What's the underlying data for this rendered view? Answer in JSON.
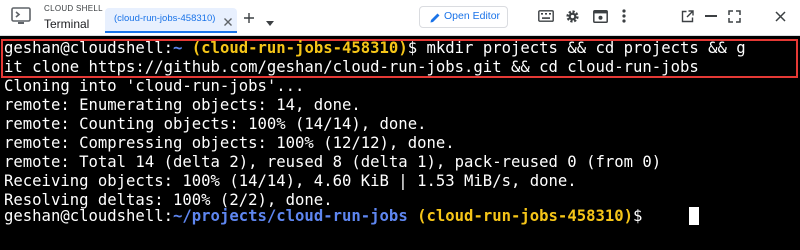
{
  "app": {
    "name": "CLOUD SHELL",
    "title": "Terminal"
  },
  "tabs": [
    {
      "label": "(cloud-run-jobs-458310)"
    }
  ],
  "toolbar": {
    "open_editor_label": "Open Editor",
    "icons": [
      "keyboard-icon",
      "gear-icon",
      "web-preview-icon",
      "more-vert-icon",
      "open-in-new-icon",
      "minimize-icon",
      "maximize-icon",
      "close-icon"
    ]
  },
  "terminal": {
    "prompt_user_host": "geshan@cloudshell",
    "prompt_sep": ":",
    "prompt_tilde": "~",
    "prompt_dollar": "$",
    "project": "(cloud-run-jobs-458310)",
    "command_line1": " mkdir projects && cd projects && g",
    "command_line2": "it clone https://github.com/geshan/cloud-run-jobs.git && cd cloud-run-jobs",
    "output": [
      "Cloning into 'cloud-run-jobs'...",
      "remote: Enumerating objects: 14, done.",
      "remote: Counting objects: 100% (14/14), done.",
      "remote: Compressing objects: 100% (12/12), done.",
      "remote: Total 14 (delta 2), reused 8 (delta 1), pack-reused 0 (from 0)",
      "Receiving objects: 100% (14/14), 4.60 KiB | 1.53 MiB/s, done.",
      "Resolving deltas: 100% (2/2), done."
    ],
    "final_path": "~/projects/cloud-run-jobs"
  },
  "colors": {
    "accent": "#1a73e8",
    "terminal_bg": "#000000",
    "path_blue": "#5e86f0",
    "project_yellow": "#f5c518",
    "highlight_red": "#e53935"
  }
}
